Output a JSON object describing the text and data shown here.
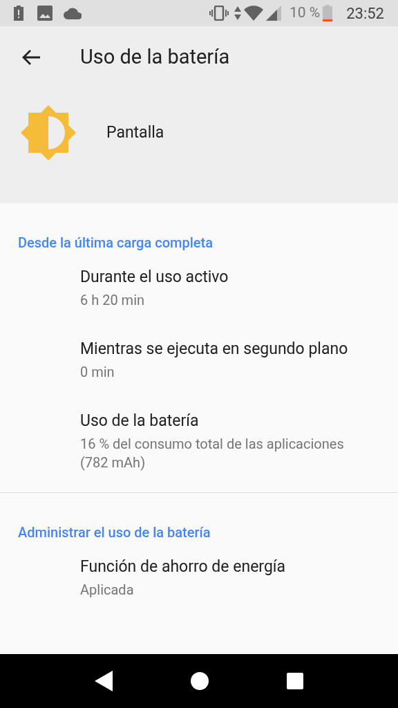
{
  "status_bar": {
    "battery_text": "10 %",
    "time": "23:52"
  },
  "app_bar": {
    "title": "Uso de la batería"
  },
  "header": {
    "app_name": "Pantalla"
  },
  "sections": [
    {
      "title": "Desde la última carga completa",
      "divider_after": true,
      "items": [
        {
          "title": "Durante el uso activo",
          "summary": "6 h 20 min"
        },
        {
          "title": "Mientras se ejecuta en segundo plano",
          "summary": "0 min"
        },
        {
          "title": "Uso de la batería",
          "summary": "16 % del consumo total de las aplicaciones (782 mAh)"
        }
      ]
    },
    {
      "title": "Administrar el uso de la batería",
      "divider_after": false,
      "items": [
        {
          "title": "Función de ahorro de energía",
          "summary": "Aplicada"
        }
      ]
    }
  ]
}
